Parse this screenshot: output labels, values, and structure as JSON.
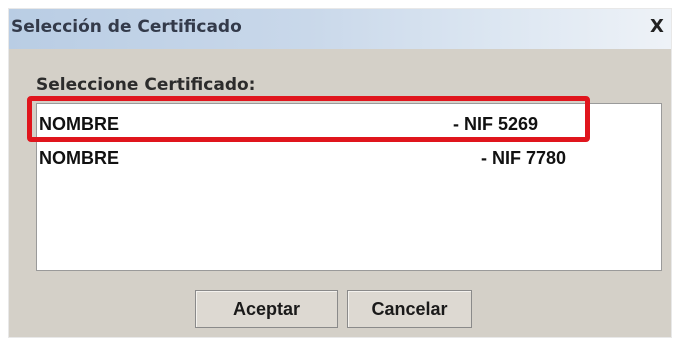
{
  "window": {
    "title": "Selección de Certificado",
    "close_glyph": "X"
  },
  "list": {
    "label": "Seleccione Certificado:",
    "items": [
      {
        "name": "NOMBRE",
        "nif": "- NIF 5269"
      },
      {
        "name": "NOMBRE",
        "nif": "- NIF 7780"
      }
    ],
    "highlight_color": "#e0151d"
  },
  "buttons": {
    "accept_label": "Aceptar",
    "cancel_label": "Cancelar"
  }
}
